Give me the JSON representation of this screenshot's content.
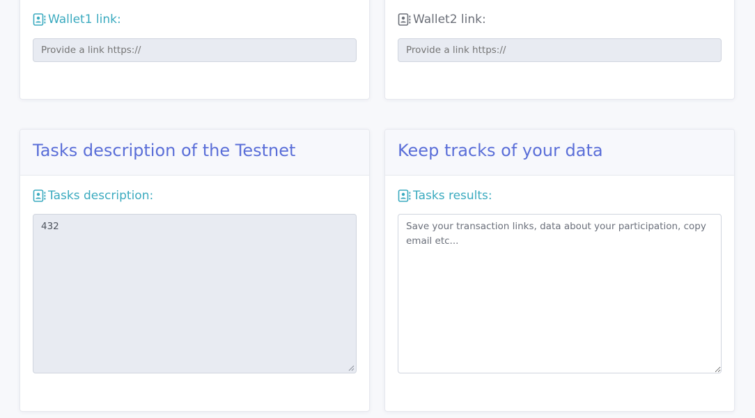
{
  "colors": {
    "accent_teal": "#3aaabf",
    "accent_blue": "#5a6ed8",
    "muted_gray": "#6b6f78",
    "field_disabled": "#e8ebf2"
  },
  "wallet1": {
    "icon": "contact-book-icon",
    "label": "Wallet1 link:",
    "placeholder": "Provide a link https://"
  },
  "wallet2": {
    "icon": "contact-book-icon",
    "label": "Wallet2 link:",
    "placeholder": "Provide a link https://"
  },
  "tasks_card": {
    "title": "Tasks description of the Testnet",
    "label": "Tasks description:",
    "icon": "contact-book-icon",
    "value": "432"
  },
  "tracks_card": {
    "title": "Keep tracks of your data",
    "label": "Tasks results:",
    "icon": "contact-book-icon",
    "placeholder": "Save your transaction links, data about your participation, copy email etc..."
  }
}
